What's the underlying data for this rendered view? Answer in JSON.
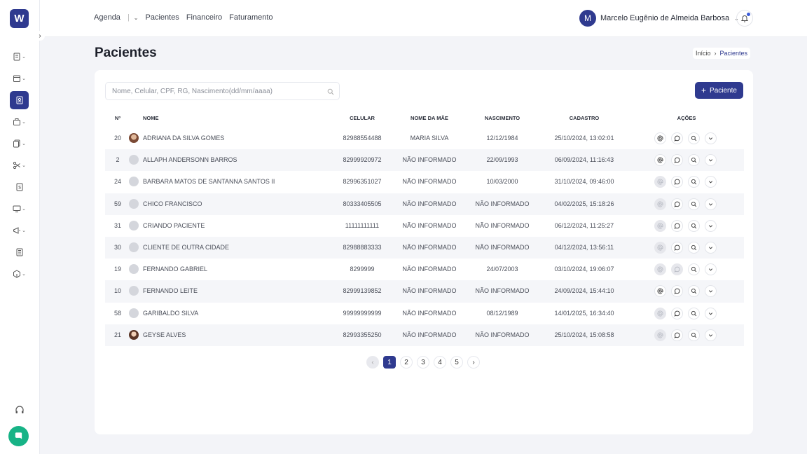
{
  "app": {
    "logo_letter": "W"
  },
  "topnav": {
    "items": [
      "Agenda",
      "Pacientes",
      "Financeiro",
      "Faturamento"
    ],
    "separator": "|"
  },
  "user": {
    "initial": "M",
    "name": "Marcelo Eugênio de Almeida Barbosa"
  },
  "page": {
    "title": "Pacientes"
  },
  "breadcrumb": {
    "home": "Início",
    "current": "Pacientes"
  },
  "search": {
    "placeholder": "Nome, Celular, CPF, RG, Nascimento(dd/mm/aaaa)",
    "value": ""
  },
  "add_button": {
    "label": "Paciente"
  },
  "table": {
    "headers": {
      "id": "Nº",
      "name": "NOME",
      "cel": "CELULAR",
      "mae": "NOME DA MÃE",
      "nasc": "NASCIMENTO",
      "cad": "CADASTRO",
      "acoes": "AÇÕES"
    },
    "rows": [
      {
        "id": "20",
        "name": "ADRIANA DA SILVA GOMES",
        "cel": "82988554488",
        "mae": "MARIA SILVA",
        "nasc": "12/12/1984",
        "cad": "25/10/2024, 13:02:01"
      },
      {
        "id": "2",
        "name": "ALLAPH ANDERSONN BARROS",
        "cel": "82999920972",
        "mae": "NÃO INFORMADO",
        "nasc": "22/09/1993",
        "cad": "06/09/2024, 11:16:43"
      },
      {
        "id": "24",
        "name": "BARBARA MATOS DE SANTANNA SANTOS II",
        "cel": "82996351027",
        "mae": "NÃO INFORMADO",
        "nasc": "10/03/2000",
        "cad": "31/10/2024, 09:46:00"
      },
      {
        "id": "59",
        "name": "CHICO FRANCISCO",
        "cel": "80333405505",
        "mae": "NÃO INFORMADO",
        "nasc": "NÃO INFORMADO",
        "cad": "04/02/2025, 15:18:26"
      },
      {
        "id": "31",
        "name": "CRIANDO PACIENTE",
        "cel": "11111111111",
        "mae": "NÃO INFORMADO",
        "nasc": "NÃO INFORMADO",
        "cad": "06/12/2024, 11:25:27"
      },
      {
        "id": "30",
        "name": "CLIENTE DE OUTRA CIDADE",
        "cel": "82988883333",
        "mae": "NÃO INFORMADO",
        "nasc": "NÃO INFORMADO",
        "cad": "04/12/2024, 13:56:11"
      },
      {
        "id": "19",
        "name": "FERNANDO GABRIEL",
        "cel": "8299999",
        "mae": "NÃO INFORMADO",
        "nasc": "24/07/2003",
        "cad": "03/10/2024, 19:06:07"
      },
      {
        "id": "10",
        "name": "FERNANDO LEITE",
        "cel": "82999139852",
        "mae": "NÃO INFORMADO",
        "nasc": "NÃO INFORMADO",
        "cad": "24/09/2024, 15:44:10"
      },
      {
        "id": "58",
        "name": "GARIBALDO SILVA",
        "cel": "99999999999",
        "mae": "NÃO INFORMADO",
        "nasc": "08/12/1989",
        "cad": "14/01/2025, 16:34:40"
      },
      {
        "id": "21",
        "name": "GEYSE ALVES",
        "cel": "82993355250",
        "mae": "NÃO INFORMADO",
        "nasc": "NÃO INFORMADO",
        "cad": "25/10/2024, 15:08:58"
      }
    ]
  },
  "pagination": {
    "pages": [
      "1",
      "2",
      "3",
      "4",
      "5"
    ],
    "current": "1"
  },
  "colors": {
    "primary": "#2f3a8f",
    "chat": "#17b386"
  }
}
